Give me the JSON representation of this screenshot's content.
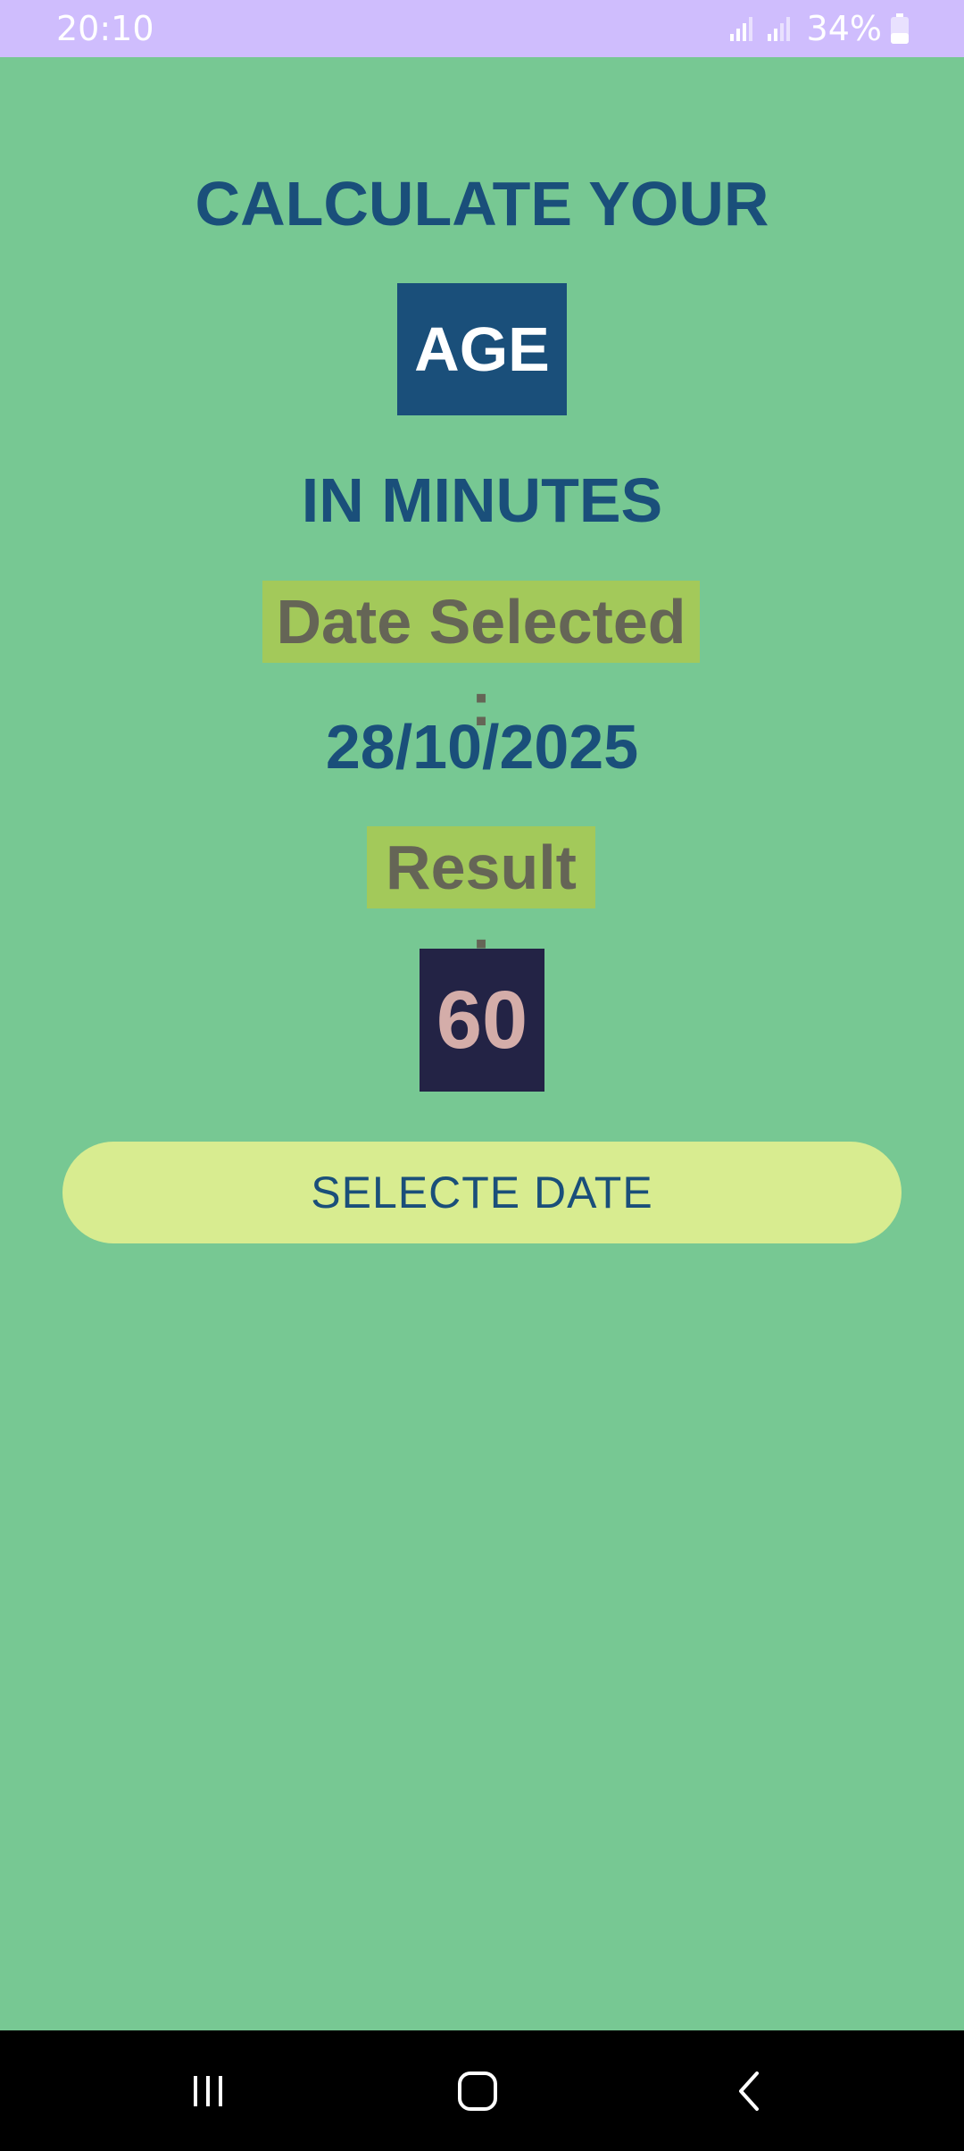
{
  "status_bar": {
    "time": "20:10",
    "battery_percent": "34%",
    "background_color": "#cfbdfd"
  },
  "header": {
    "line1": "CALCULATE YOUR",
    "age_label": "AGE",
    "line3": "IN MINUTES"
  },
  "date_section": {
    "label": "Date Selected :",
    "value": "28/10/2025"
  },
  "result_section": {
    "label": "Result :",
    "value": "60"
  },
  "action": {
    "select_date_label": "SELECTE DATE"
  },
  "nav_bar": {
    "icons": [
      "recents-icon",
      "home-icon",
      "back-icon"
    ]
  },
  "colors": {
    "background": "#77c893",
    "primary_text": "#1a4f7a",
    "label_highlight": "#a3c95a",
    "label_text": "#656556",
    "result_box": "#232345",
    "result_text": "#d4ada9",
    "button": "#d8ec90"
  }
}
